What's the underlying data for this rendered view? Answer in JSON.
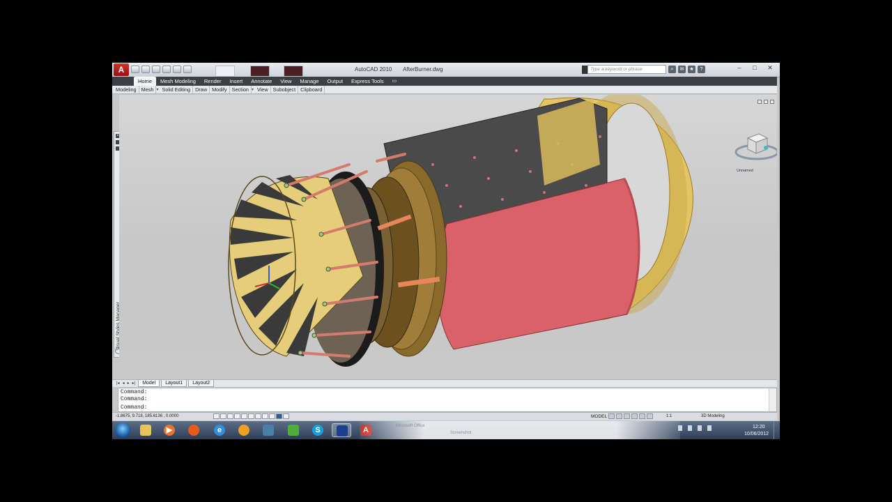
{
  "window": {
    "app_name": "AutoCAD 2010",
    "file_name": "AfterBurner.dwg",
    "search_placeholder": "Type a keyword or phrase",
    "controls": [
      "minimize",
      "maximize",
      "close"
    ]
  },
  "ribbon": {
    "tabs": [
      "Home",
      "Mesh Modeling",
      "Render",
      "Insert",
      "Annotate",
      "View",
      "Manage",
      "Output",
      "Express Tools"
    ],
    "active_tab": "Home",
    "panels": [
      "Modeling",
      "Mesh",
      "Solid Editing",
      "Draw",
      "Modify",
      "Section",
      "View",
      "Subobject",
      "Clipboard"
    ]
  },
  "viewport": {
    "viewcube_label": "Unnamed"
  },
  "palette": {
    "title": "Visual Styles Manager"
  },
  "layout_tabs": [
    "Model",
    "Layout1",
    "Layout2"
  ],
  "command_line": {
    "lines": [
      "Command:",
      "Command:",
      "Command:"
    ]
  },
  "status": {
    "coordinates": "-1.8675, 9.718, 185.6136 , 0.0000",
    "model_label": "MODEL",
    "annotation_scale": "1:1",
    "workspace": "3D Modeling"
  },
  "taskbar": {
    "apps": [
      "windows-explorer",
      "media-player",
      "firefox",
      "internet-explorer",
      "app-5",
      "app-6",
      "app-7",
      "skype",
      "app-9",
      "autocad"
    ],
    "blurred_items": [
      "Microsoft Office",
      "Screenshot"
    ],
    "time": "12:20",
    "date": "10/06/2012"
  },
  "colors": {
    "shell_red": "#d9616a",
    "tan_gold": "#e3c663",
    "bronze": "#8a6a2c",
    "ribbon_dark": "#3c3f43"
  }
}
